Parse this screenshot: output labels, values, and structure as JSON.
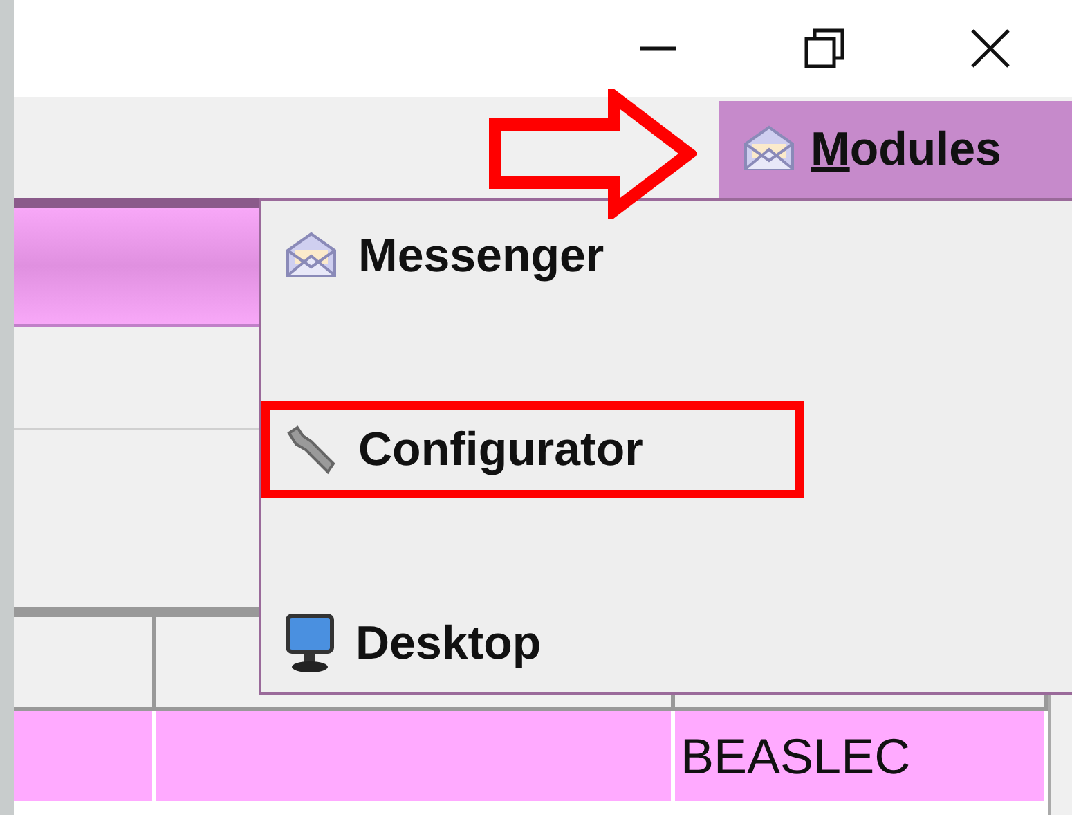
{
  "menu_bar": {
    "menus": [
      {
        "label": "Modules",
        "selected": true
      }
    ]
  },
  "popup_menu": {
    "items": [
      {
        "label": "Messenger",
        "outlined": false
      },
      {
        "label": "Configurator",
        "outlined": true
      },
      {
        "label": "Desktop",
        "outlined": false
      }
    ]
  },
  "table": {
    "rows": [
      {
        "selected": true,
        "cells": [
          "",
          "",
          "BEASLEC"
        ]
      },
      {
        "selected": false
      }
    ]
  }
}
